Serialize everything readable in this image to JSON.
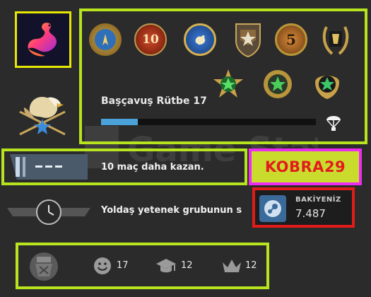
{
  "rank": {
    "title": "Başçavuş Rütbe 17",
    "xp_progress": 0.17
  },
  "win_prompt": "10 maç daha kazan.",
  "skill_group_text": "Yoldaş yetenek grubunun s",
  "player": {
    "name": "KOBRA29"
  },
  "wallet": {
    "label": "BAKİYENİZ",
    "value": "7.487"
  },
  "stats": {
    "friendly": "17",
    "teacher": "12",
    "leader": "12"
  },
  "medals": [
    "10",
    "5"
  ],
  "colors": {
    "highlight_green": "#b7e31f",
    "highlight_magenta": "#ee2bf1",
    "highlight_red": "#e11a1a",
    "xp_blue": "#4aa2d9"
  },
  "icons": [
    "avatar-swan-icon",
    "eagle-rank-icon",
    "parachute-icon",
    "smiley-icon",
    "graduation-cap-icon",
    "crown-icon",
    "steam-icon",
    "stopwatch-wings-icon",
    "skill-badge-icon"
  ]
}
